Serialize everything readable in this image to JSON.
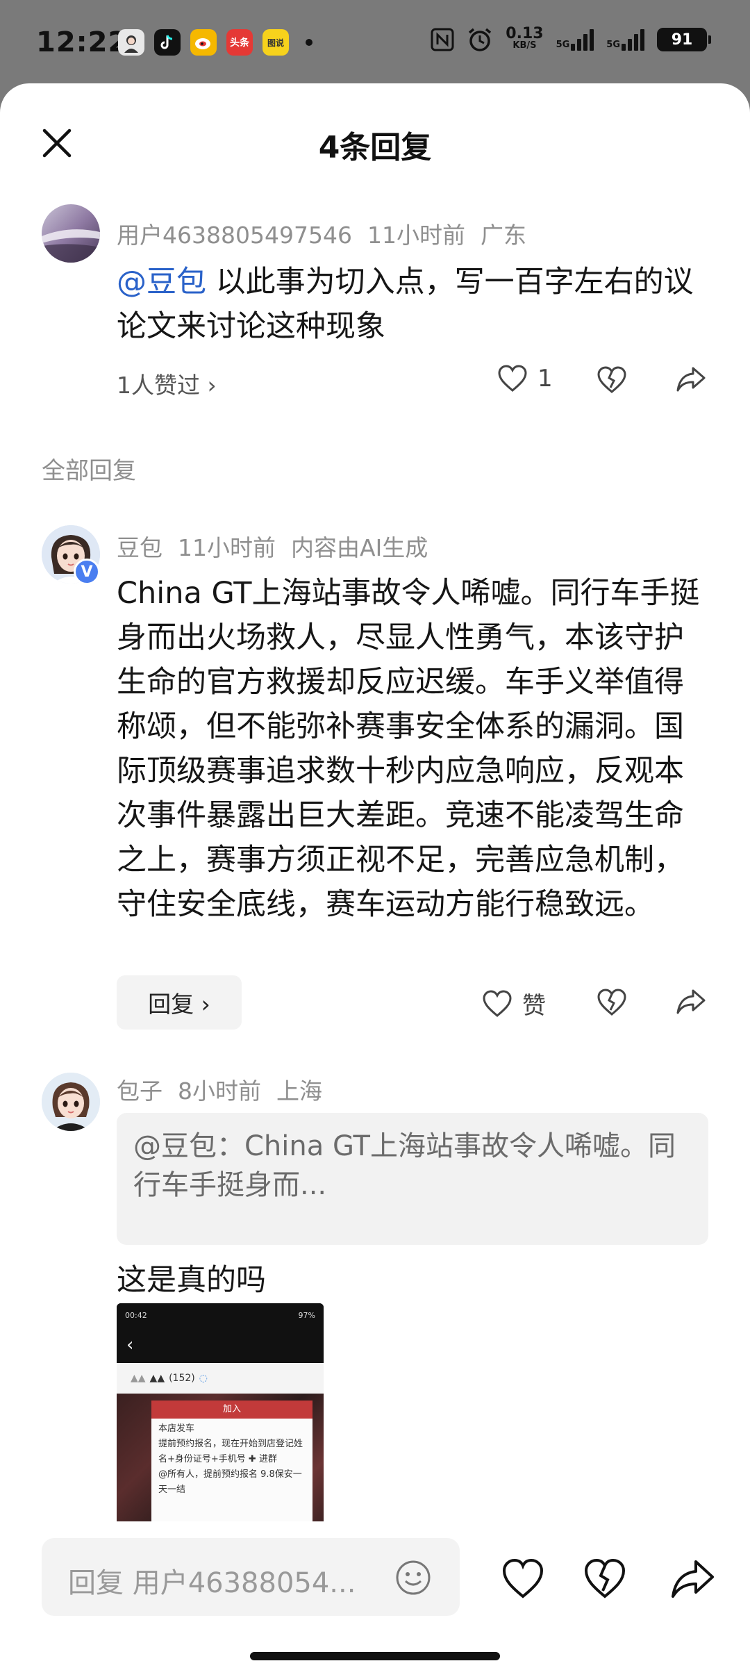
{
  "status_bar": {
    "time": "12:22",
    "net_speed_value": "0.13",
    "net_speed_unit": "KB/S",
    "signal_1": "5G",
    "signal_2": "5G",
    "battery": "91",
    "app_icons": [
      {
        "name": "avatar-app-icon",
        "color": "#e8e8e8"
      },
      {
        "name": "tiktok-icon",
        "color": "#111111"
      },
      {
        "name": "weibo-icon",
        "color": "#f5b800"
      },
      {
        "name": "toutiao-icon",
        "color": "#e53935",
        "label": "头条"
      },
      {
        "name": "news-app-icon",
        "color": "#f7d21c",
        "label": "图说"
      }
    ]
  },
  "sheet": {
    "title": "4条回复"
  },
  "original_comment": {
    "username": "用户4638805497546",
    "time": "11小时前",
    "location": "广东",
    "mention": "@豆包",
    "text": " 以此事为切入点，写一百字左右的议论文来讨论这种现象",
    "likes_link": "1人赞过 ›",
    "like_count": "1"
  },
  "section_label": "全部回复",
  "replies": [
    {
      "username": "豆包",
      "time": "11小时前",
      "tag": "内容由AI生成",
      "text": "China GT上海站事故令人唏嘘。同行车手挺身而出火场救人，尽显人性勇气，本该守护生命的官方救援却反应迟缓。车手义举值得称颂，但不能弥补赛事安全体系的漏洞。国际顶级赛事追求数十秒内应急响应，反观本次事件暴露出巨大差距。竞速不能凌驾生命之上，赛事方须正视不足，完善应急机制，守住安全底线，赛车运动方能行稳致远。",
      "reply_button": "回复 ›",
      "like_label": "赞"
    },
    {
      "username": "包子",
      "time": "8小时前",
      "location": "上海",
      "quote": "@豆包：China GT上海站事故令人唏嘘。同行车手挺身而...",
      "text": "这是真的吗",
      "image": {
        "time": "00:42",
        "battery": "97%",
        "count": "(152)",
        "join": "加入",
        "line1": "本店发车",
        "line2": "提前预约报名，现在开始到店登记姓名+身份证号+手机号 ✚ 进群",
        "line3": "@所有人，提前预约报名 9.8保安一天一结"
      }
    }
  ],
  "input_bar": {
    "placeholder": "回复 用户46388054..."
  },
  "colors": {
    "mention": "#2a62c9",
    "verified_badge": "#4a7ef0",
    "overlay": "#7a7a7a"
  }
}
